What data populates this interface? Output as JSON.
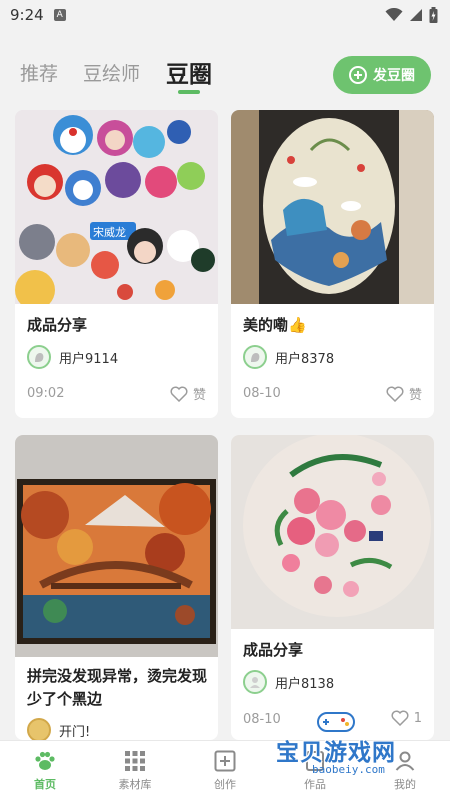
{
  "status_bar": {
    "time": "9:24",
    "notif_icon": "A"
  },
  "tabs": [
    {
      "label": "推荐",
      "active": false
    },
    {
      "label": "豆绘师",
      "active": false
    },
    {
      "label": "豆圈",
      "active": true
    }
  ],
  "post_button": {
    "label": "发豆圈",
    "icon": "plus-circle-icon"
  },
  "accent_color": "#6ec36f",
  "cards": [
    {
      "title": "成品分享",
      "user": "用户9114",
      "date": "09:02",
      "likes": "赞"
    },
    {
      "title": "美的嘞👍",
      "user": "用户8378",
      "date": "08-10",
      "likes": "赞"
    },
    {
      "title": "拼完没发现异常，烫完发现少了个黑边",
      "user": "开门!",
      "date": "",
      "likes": ""
    },
    {
      "title": "成品分享",
      "user": "用户8138",
      "date": "08-10",
      "likes": "1"
    }
  ],
  "card1_image_text": "宋威龙",
  "bottom_nav": [
    {
      "label": "首页",
      "icon": "paw-icon",
      "active": true
    },
    {
      "label": "素材库",
      "icon": "grid-icon",
      "active": false
    },
    {
      "label": "创作",
      "icon": "plus-square-icon",
      "active": false
    },
    {
      "label": "作品",
      "icon": "work-icon",
      "active": false
    },
    {
      "label": "我的",
      "icon": "user-icon",
      "active": false
    }
  ],
  "watermark": {
    "text": "宝贝游戏网",
    "url": "baobeiy.com"
  }
}
